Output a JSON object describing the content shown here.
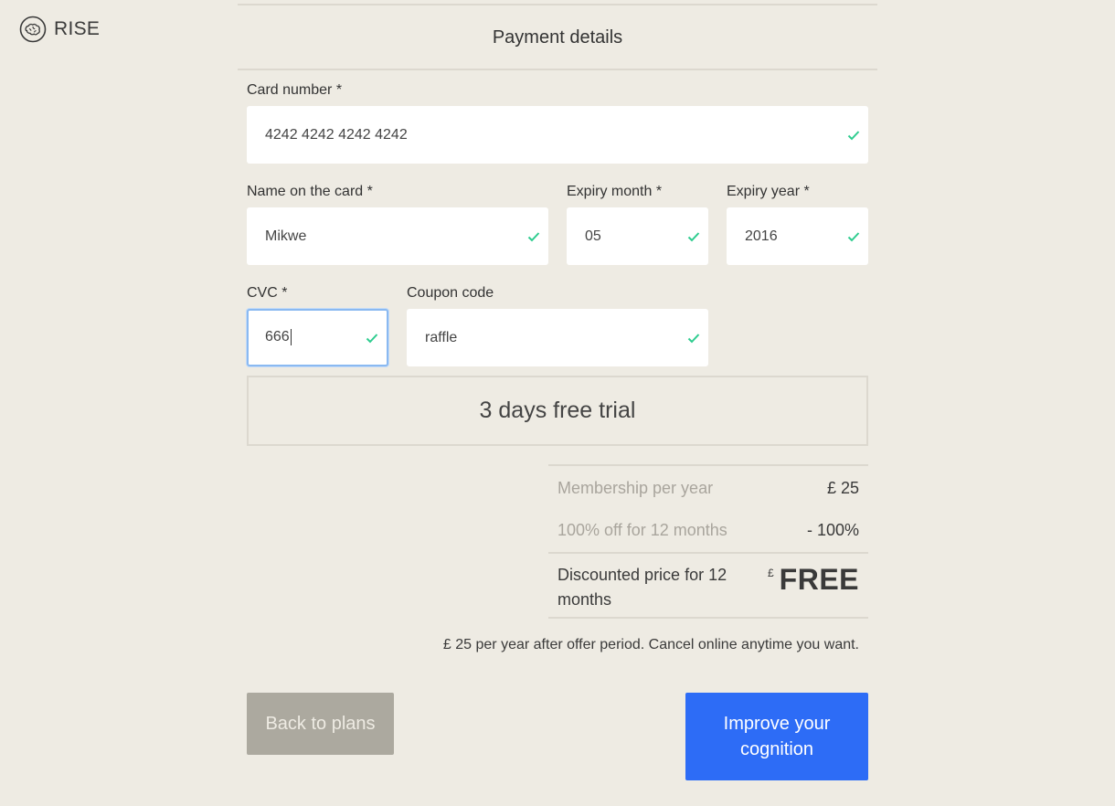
{
  "brand": {
    "name": "RISE",
    "icon": "brain-icon"
  },
  "header": {
    "title": "Payment details"
  },
  "form": {
    "card_number": {
      "label": "Card number *",
      "value": "4242 4242 4242 4242",
      "valid": true
    },
    "name_on_card": {
      "label": "Name on the card *",
      "value": "Mikwe",
      "valid": true
    },
    "expiry_month": {
      "label": "Expiry month *",
      "value": "05",
      "valid": true
    },
    "expiry_year": {
      "label": "Expiry year *",
      "value": "2016",
      "valid": true
    },
    "cvc": {
      "label": "CVC *",
      "value": "666",
      "valid": true,
      "focused": true
    },
    "coupon": {
      "label": "Coupon code",
      "value": "raffle",
      "valid": true
    }
  },
  "trial": {
    "text": "3 days free trial"
  },
  "summary": {
    "membership_label": "Membership per year",
    "membership_amount": "£ 25",
    "discount_label": "100% off for 12 months",
    "discount_amount": "- 100%",
    "discounted_label": "Discounted price for 12 months",
    "discounted_currency": "£",
    "discounted_value": "FREE"
  },
  "note": "£ 25 per year after offer period. Cancel online anytime you want.",
  "buttons": {
    "back": "Back to plans",
    "improve": "Improve your cognition"
  },
  "colors": {
    "background": "#eeebe3",
    "valid_check": "#2ecc8f",
    "primary": "#2d6cf6",
    "secondary": "#aca99f",
    "focus_border": "#8ab9f1"
  }
}
